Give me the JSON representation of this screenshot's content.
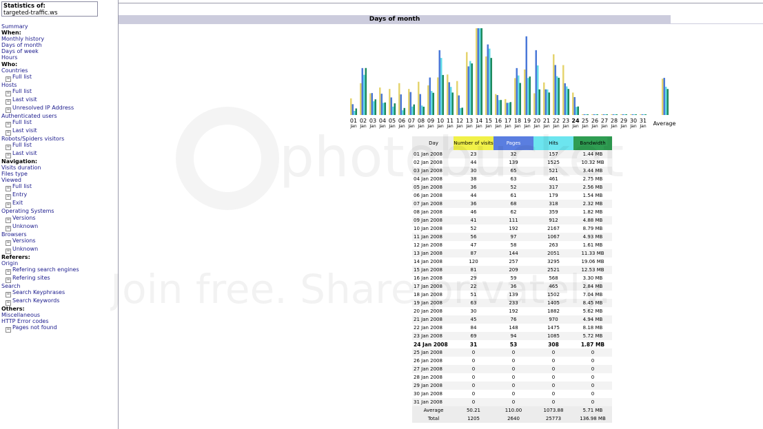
{
  "site": {
    "label": "Statistics of:",
    "name": "targeted-traffic.ws"
  },
  "menu": [
    {
      "t": "link",
      "text": "Summary"
    },
    {
      "t": "head",
      "text": "When:"
    },
    {
      "t": "link",
      "text": "Monthly history"
    },
    {
      "t": "link",
      "text": "Days of month"
    },
    {
      "t": "link",
      "text": "Days of week"
    },
    {
      "t": "link",
      "text": "Hours"
    },
    {
      "t": "head",
      "text": "Who:"
    },
    {
      "t": "link",
      "text": "Countries"
    },
    {
      "t": "sub",
      "text": "Full list"
    },
    {
      "t": "link",
      "text": "Hosts"
    },
    {
      "t": "sub",
      "text": "Full list"
    },
    {
      "t": "sub",
      "text": "Last visit"
    },
    {
      "t": "sub",
      "text": "Unresolved IP Address"
    },
    {
      "t": "link",
      "text": "Authenticated users"
    },
    {
      "t": "sub",
      "text": "Full list"
    },
    {
      "t": "sub",
      "text": "Last visit"
    },
    {
      "t": "link",
      "text": "Robots/Spiders visitors"
    },
    {
      "t": "sub",
      "text": "Full list"
    },
    {
      "t": "sub",
      "text": "Last visit"
    },
    {
      "t": "head",
      "text": "Navigation:"
    },
    {
      "t": "link",
      "text": "Visits duration"
    },
    {
      "t": "link",
      "text": "Files type"
    },
    {
      "t": "link",
      "text": "Viewed"
    },
    {
      "t": "sub",
      "text": "Full list"
    },
    {
      "t": "sub",
      "text": "Entry"
    },
    {
      "t": "sub",
      "text": "Exit"
    },
    {
      "t": "link",
      "text": "Operating Systems"
    },
    {
      "t": "sub",
      "text": "Versions"
    },
    {
      "t": "sub",
      "text": "Unknown"
    },
    {
      "t": "link",
      "text": "Browsers"
    },
    {
      "t": "sub",
      "text": "Versions"
    },
    {
      "t": "sub",
      "text": "Unknown"
    },
    {
      "t": "head",
      "text": "Referers:"
    },
    {
      "t": "link",
      "text": "Origin"
    },
    {
      "t": "sub",
      "text": "Refering search engines"
    },
    {
      "t": "sub",
      "text": "Refering sites"
    },
    {
      "t": "link",
      "text": "Search"
    },
    {
      "t": "sub",
      "text": "Search Keyphrases"
    },
    {
      "t": "sub",
      "text": "Search Keywords"
    },
    {
      "t": "head",
      "text": "Others:"
    },
    {
      "t": "link",
      "text": "Miscellaneous"
    },
    {
      "t": "link",
      "text": "HTTP Error codes"
    },
    {
      "t": "sub",
      "text": "Pages not found"
    }
  ],
  "section_title": "Days of month",
  "chart_data": {
    "type": "bar",
    "categories": [
      "01",
      "02",
      "03",
      "04",
      "05",
      "06",
      "07",
      "08",
      "09",
      "10",
      "11",
      "12",
      "13",
      "14",
      "15",
      "16",
      "17",
      "18",
      "19",
      "20",
      "21",
      "22",
      "23",
      "24",
      "25",
      "26",
      "27",
      "28",
      "29",
      "30",
      "31"
    ],
    "sub_label": "Jan",
    "current_day": "24",
    "average_label": "Average",
    "series": [
      {
        "name": "Number of visits",
        "color": "#e5d46f",
        "values": [
          23,
          44,
          30,
          38,
          36,
          44,
          36,
          46,
          41,
          52,
          56,
          47,
          87,
          120,
          81,
          29,
          22,
          51,
          63,
          30,
          45,
          84,
          69,
          31,
          0,
          0,
          0,
          0,
          0,
          0,
          0
        ],
        "average": 50.21
      },
      {
        "name": "Pages",
        "color": "#4a78d8",
        "values": [
          32,
          139,
          65,
          63,
          52,
          61,
          68,
          62,
          111,
          192,
          97,
          58,
          144,
          257,
          209,
          59,
          36,
          139,
          233,
          192,
          76,
          148,
          94,
          53,
          0,
          0,
          0,
          0,
          0,
          0,
          0
        ],
        "average": 110.0
      },
      {
        "name": "Hits",
        "color": "#62dbe8",
        "values": [
          157,
          1525,
          521,
          461,
          317,
          179,
          318,
          359,
          912,
          2167,
          1067,
          263,
          2051,
          3295,
          2521,
          568,
          465,
          1502,
          1405,
          1882,
          970,
          1475,
          1085,
          308,
          0,
          0,
          0,
          0,
          0,
          0,
          0
        ],
        "average": 1073.88
      },
      {
        "name": "Bandwidth",
        "color": "#1f8a5c",
        "values": [
          1.44,
          10.32,
          3.44,
          2.75,
          2.56,
          1.54,
          2.32,
          1.82,
          4.88,
          8.79,
          4.93,
          1.61,
          11.33,
          19.06,
          12.53,
          3.3,
          2.84,
          7.04,
          8.45,
          5.62,
          4.94,
          8.18,
          5.72,
          1.87,
          0,
          0,
          0,
          0,
          0,
          0,
          0
        ],
        "average": 5.71
      }
    ]
  },
  "table": {
    "headers": {
      "day": "Day",
      "visits": "Number of visits",
      "pages": "Pages",
      "hits": "Hits",
      "bandwidth": "Bandwidth"
    },
    "header_colors": {
      "visits": "#f1f149",
      "pages": "#5a7ee0",
      "hits": "#6ce5ef",
      "bandwidth": "#2f9d52"
    },
    "rows": [
      [
        "01 Jan 2008",
        "23",
        "32",
        "157",
        "1.44 MB"
      ],
      [
        "02 Jan 2008",
        "44",
        "139",
        "1525",
        "10.32 MB"
      ],
      [
        "03 Jan 2008",
        "30",
        "65",
        "521",
        "3.44 MB"
      ],
      [
        "04 Jan 2008",
        "38",
        "63",
        "461",
        "2.75 MB"
      ],
      [
        "05 Jan 2008",
        "36",
        "52",
        "317",
        "2.56 MB"
      ],
      [
        "06 Jan 2008",
        "44",
        "61",
        "179",
        "1.54 MB"
      ],
      [
        "07 Jan 2008",
        "36",
        "68",
        "318",
        "2.32 MB"
      ],
      [
        "08 Jan 2008",
        "46",
        "62",
        "359",
        "1.82 MB"
      ],
      [
        "09 Jan 2008",
        "41",
        "111",
        "912",
        "4.88 MB"
      ],
      [
        "10 Jan 2008",
        "52",
        "192",
        "2167",
        "8.79 MB"
      ],
      [
        "11 Jan 2008",
        "56",
        "97",
        "1067",
        "4.93 MB"
      ],
      [
        "12 Jan 2008",
        "47",
        "58",
        "263",
        "1.61 MB"
      ],
      [
        "13 Jan 2008",
        "87",
        "144",
        "2051",
        "11.33 MB"
      ],
      [
        "14 Jan 2008",
        "120",
        "257",
        "3295",
        "19.06 MB"
      ],
      [
        "15 Jan 2008",
        "81",
        "209",
        "2521",
        "12.53 MB"
      ],
      [
        "16 Jan 2008",
        "29",
        "59",
        "568",
        "3.30 MB"
      ],
      [
        "17 Jan 2008",
        "22",
        "36",
        "465",
        "2.84 MB"
      ],
      [
        "18 Jan 2008",
        "51",
        "139",
        "1502",
        "7.04 MB"
      ],
      [
        "19 Jan 2008",
        "63",
        "233",
        "1405",
        "8.45 MB"
      ],
      [
        "20 Jan 2008",
        "30",
        "192",
        "1882",
        "5.62 MB"
      ],
      [
        "21 Jan 2008",
        "45",
        "76",
        "970",
        "4.94 MB"
      ],
      [
        "22 Jan 2008",
        "84",
        "148",
        "1475",
        "8.18 MB"
      ],
      [
        "23 Jan 2008",
        "69",
        "94",
        "1085",
        "5.72 MB"
      ],
      [
        "24 Jan 2008",
        "31",
        "53",
        "308",
        "1.87 MB"
      ],
      [
        "25 Jan 2008",
        "0",
        "0",
        "0",
        "0"
      ],
      [
        "26 Jan 2008",
        "0",
        "0",
        "0",
        "0"
      ],
      [
        "27 Jan 2008",
        "0",
        "0",
        "0",
        "0"
      ],
      [
        "28 Jan 2008",
        "0",
        "0",
        "0",
        "0"
      ],
      [
        "29 Jan 2008",
        "0",
        "0",
        "0",
        "0"
      ],
      [
        "30 Jan 2008",
        "0",
        "0",
        "0",
        "0"
      ],
      [
        "31 Jan 2008",
        "0",
        "0",
        "0",
        "0"
      ]
    ],
    "current_row_index": 23,
    "average": [
      "Average",
      "50.21",
      "110.00",
      "1073.88",
      "5.71 MB"
    ],
    "total": [
      "Total",
      "1205",
      "2640",
      "25773",
      "136.98 MB"
    ]
  },
  "watermark": {
    "logo_text": "photobucket",
    "tagline": "Join free. Share privately."
  }
}
